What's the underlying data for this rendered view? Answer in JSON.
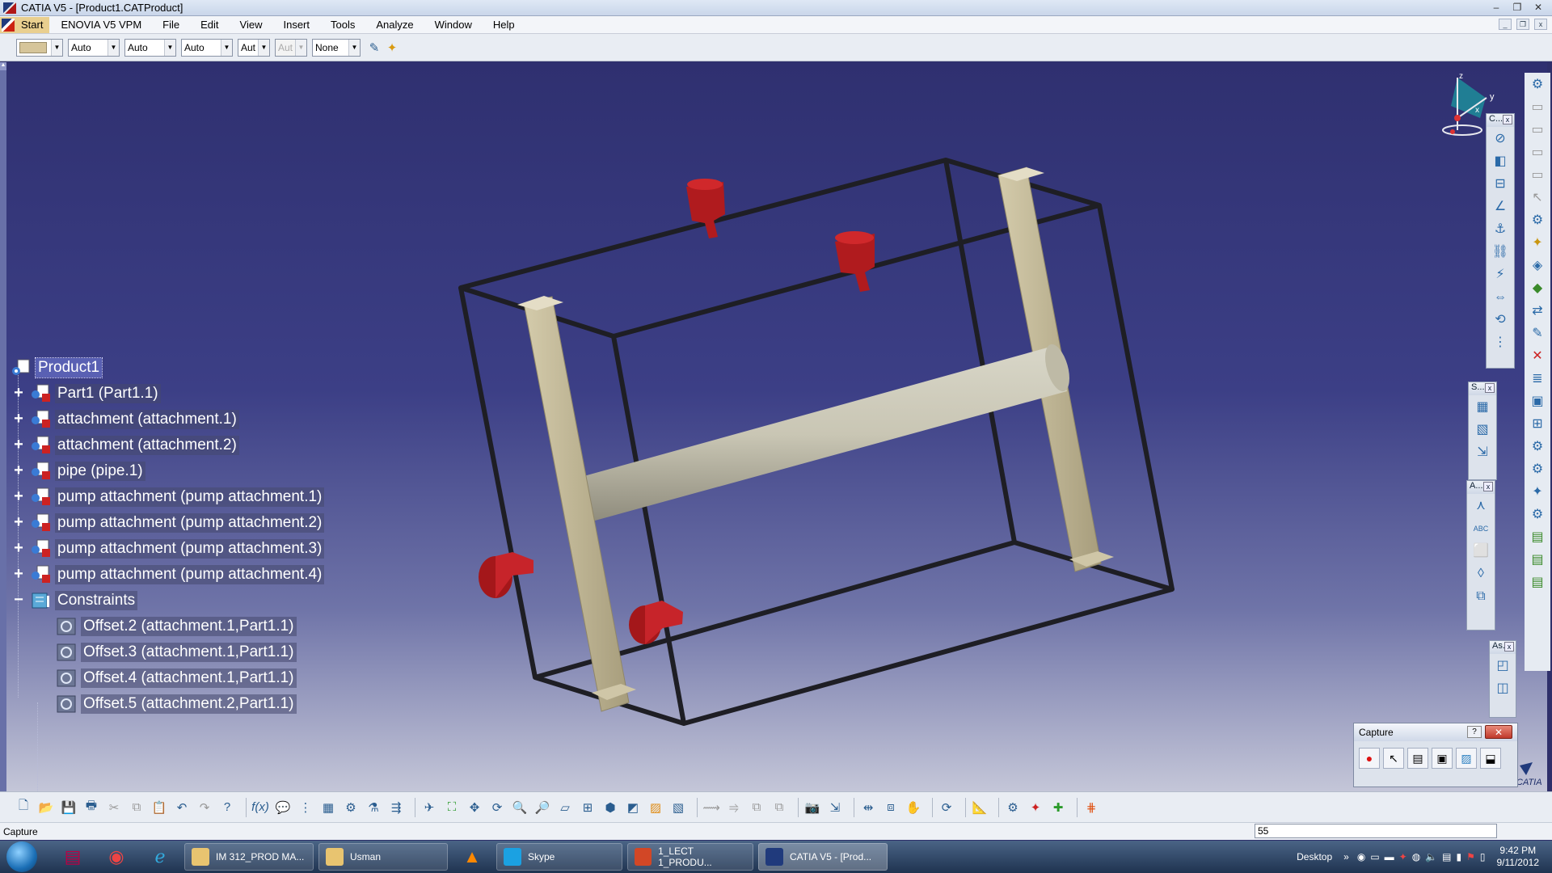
{
  "window": {
    "title": "CATIA V5 - [Product1.CATProduct]",
    "controls": [
      "–",
      "❐",
      "✕"
    ]
  },
  "menu": {
    "start": "Start",
    "items": [
      "ENOVIA V5 VPM",
      "File",
      "Edit",
      "View",
      "Insert",
      "Tools",
      "Analyze",
      "Window",
      "Help"
    ]
  },
  "properties_toolbar": {
    "color_value": "#d6c59a",
    "transparency": "Auto",
    "line_thickness": "Auto",
    "line_type": "Auto",
    "point_type": "Aut",
    "layer_disabled": "Aut",
    "layer": "None"
  },
  "spec_tree": {
    "root": "Product1",
    "items": [
      {
        "label": "Part1 (Part1.1)",
        "icon": "part-icon"
      },
      {
        "label": "attachment (attachment.1)",
        "icon": "part-icon"
      },
      {
        "label": "attachment (attachment.2)",
        "icon": "part-icon"
      },
      {
        "label": "pipe (pipe.1)",
        "icon": "part-icon"
      },
      {
        "label": "pump attachment (pump attachment.1)",
        "icon": "part-icon"
      },
      {
        "label": "pump attachment (pump attachment.2)",
        "icon": "part-icon"
      },
      {
        "label": "pump attachment (pump attachment.3)",
        "icon": "part-icon"
      },
      {
        "label": "pump attachment (pump attachment.4)",
        "icon": "part-icon"
      }
    ],
    "constraints_label": "Constraints",
    "constraints": [
      "Offset.2 (attachment.1,Part1.1)",
      "Offset.3 (attachment.1,Part1.1)",
      "Offset.4 (attachment.1,Part1.1)",
      "Offset.5 (attachment.2,Part1.1)"
    ]
  },
  "compass_labels": {
    "z": "z",
    "y": "y",
    "x": "x"
  },
  "right_toolbars": {
    "constraints_title": "C...",
    "space_title": "S...",
    "annot_title": "A...",
    "assembly_title": "As..."
  },
  "capture_dialog": {
    "title": "Capture",
    "help": "?",
    "close": "✕"
  },
  "status": {
    "message": "Capture",
    "command_value": "55"
  },
  "taskbar": {
    "tasks": [
      {
        "label": "IM 312_PROD MA...",
        "color": "#e8c470"
      },
      {
        "label": "Usman",
        "color": "#e8c470"
      },
      {
        "label": "Skype",
        "color": "#1ba1e2"
      },
      {
        "label": "1_LECT 1_PRODU...",
        "color": "#d24726"
      },
      {
        "label": "CATIA V5 - [Prod...",
        "color": "#203a7c"
      }
    ],
    "desktop_label": "Desktop",
    "time": "9:42 PM",
    "date": "9/11/2012"
  },
  "logo_text": "CATIA"
}
